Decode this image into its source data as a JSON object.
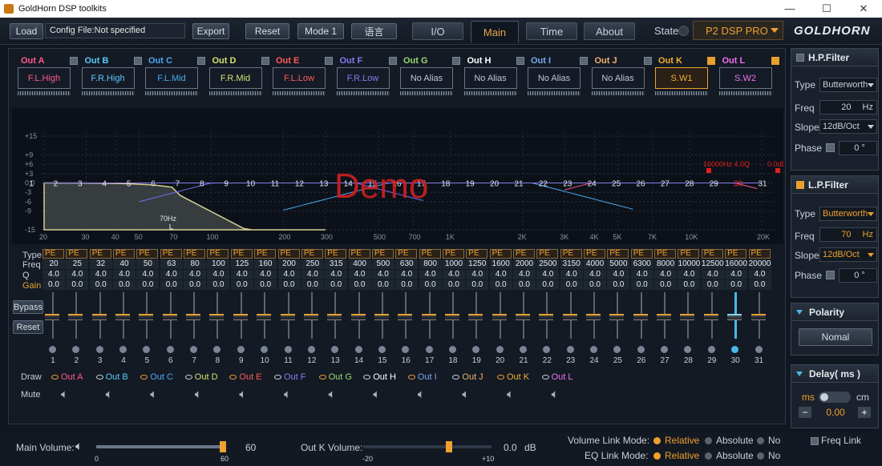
{
  "titlebar": {
    "title": "GoldHorn DSP toolkits",
    "min": "—",
    "max": "☐",
    "close": "✕"
  },
  "toolbar": {
    "load": "Load",
    "config": "Config File:Not specified",
    "export": "Export",
    "reset": "Reset",
    "mode": "Mode 1",
    "lang": "语言"
  },
  "tabs": [
    "I/O",
    "Main",
    "Time",
    "About"
  ],
  "state": {
    "label": "State",
    "device": "P2 DSP PRO"
  },
  "logo": "GOLDHORN",
  "outputs": [
    {
      "name": "Out  A",
      "alias": "F.L.High",
      "color": "#ff5a8c",
      "checked": false
    },
    {
      "name": "Out  B",
      "alias": "F.R.High",
      "color": "#5ac8ff",
      "checked": false
    },
    {
      "name": "Out  C",
      "alias": "F.L.Mid",
      "color": "#4aa8f0",
      "checked": false
    },
    {
      "name": "Out  D",
      "alias": "F.R.Mid",
      "color": "#d8e070",
      "checked": false
    },
    {
      "name": "Out  E",
      "alias": "F.L.Low",
      "color": "#ff5a5a",
      "checked": false
    },
    {
      "name": "Out  F",
      "alias": "F.R.Low",
      "color": "#8a7af0",
      "checked": false
    },
    {
      "name": "Out  G",
      "alias": "No Alias",
      "color": "#9ad870",
      "checked": false
    },
    {
      "name": "Out  H",
      "alias": "No Alias",
      "color": "#ffffff",
      "checked": false
    },
    {
      "name": "Out  I",
      "alias": "No Alias",
      "color": "#7aa8f0",
      "checked": false
    },
    {
      "name": "Out  J",
      "alias": "No Alias",
      "color": "#f0b070",
      "checked": false
    },
    {
      "name": "Out  K",
      "alias": "S.W1",
      "color": "#f0b030",
      "checked": true
    },
    {
      "name": "Out  L",
      "alias": "S.W2",
      "color": "#f070f0",
      "checked": true
    }
  ],
  "chart": {
    "ylabels": [
      "+15",
      "+9",
      "+6",
      "+3",
      "0.0",
      "-3",
      "-6",
      "-9",
      "-15"
    ],
    "xlabels": [
      "20",
      "30",
      "40",
      "50",
      "70",
      "100",
      "200",
      "300",
      "500",
      "700",
      "1K",
      "2K",
      "3K",
      "4K",
      "5K",
      "7K",
      "10K",
      "20K"
    ],
    "points": [
      "1",
      "2",
      "3",
      "4",
      "5",
      "6",
      "7",
      "8",
      "9",
      "10",
      "11",
      "12",
      "13",
      "14",
      "15",
      "16",
      "17",
      "18",
      "19",
      "20",
      "21",
      "22",
      "23",
      "24",
      "25",
      "26",
      "27",
      "28",
      "29",
      "30",
      "31"
    ],
    "marker": "70Hz",
    "selinfo": "16000Hz 4.0Q",
    "selgain": "0.0dB",
    "watermark": "Demo"
  },
  "eq": {
    "labels": {
      "type": "Type",
      "freq": "Freq",
      "q": "Q",
      "gain": "Gain"
    },
    "type": "PE",
    "freqs": [
      "20",
      "25",
      "32",
      "40",
      "50",
      "63",
      "80",
      "100",
      "125",
      "160",
      "200",
      "250",
      "315",
      "400",
      "500",
      "630",
      "800",
      "1000",
      "1250",
      "1600",
      "2000",
      "2500",
      "3150",
      "4000",
      "5000",
      "6300",
      "8000",
      "10000",
      "12500",
      "16000",
      "20000"
    ],
    "q": "4.0",
    "gain": "0.0"
  },
  "buttons": {
    "bypass": "Bypass",
    "reset": "Reset"
  },
  "draw": {
    "label": "Draw",
    "mute": "Mute",
    "items": [
      "Out  A",
      "Out  B",
      "Out  C",
      "Out  D",
      "Out  E",
      "Out  F",
      "Out  G",
      "Out  H",
      "Out  I",
      "Out  J",
      "Out  K",
      "Out  L"
    ]
  },
  "hpf": {
    "title": "H.P.Filter",
    "type_l": "Type",
    "type": "Butterworth",
    "freq_l": "Freq",
    "freq": "20",
    "unit": "Hz",
    "slope_l": "Slope",
    "slope": "12dB/Oct",
    "phase_l": "Phase",
    "phase": "0",
    "deg": "°"
  },
  "lpf": {
    "title": "L.P.Filter",
    "type_l": "Type",
    "type": "Butterworth",
    "freq_l": "Freq",
    "freq": "70",
    "unit": "Hz",
    "slope_l": "Slope",
    "slope": "12dB/Oct",
    "phase_l": "Phase",
    "phase": "0",
    "deg": "°"
  },
  "polarity": {
    "title": "Polarity",
    "value": "Nomal"
  },
  "delay": {
    "title": "Delay( ms )",
    "ms": "ms",
    "cm": "cm",
    "value": "0.00",
    "minus": "−",
    "plus": "+"
  },
  "bottom": {
    "main_vol_l": "Main Volume:",
    "main_vol": "60",
    "mv_min": "0",
    "mv_max": "60",
    "mv_level": 1.0,
    "outk_l": "Out K Volume:",
    "outk": "0.0",
    "db": "dB",
    "ok_min": "-20",
    "ok_max": "+10",
    "ok_level": 0.667,
    "vlm": "Volume Link Mode:",
    "eqlm": "EQ Link Mode:",
    "relative": "Relative",
    "absolute": "Absolute",
    "no": "No",
    "freqlink": "Freq Link"
  },
  "colors": {
    "accent": "#f0a030",
    "select": "#4ab8e8"
  }
}
